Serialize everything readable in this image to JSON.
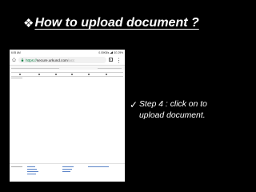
{
  "slide": {
    "title_bullet": "❖",
    "title": "How to upload document ?",
    "step_bullet": "✓",
    "step_text": "Step 4 : click on to upload document.",
    "colors": {
      "background": "#000000",
      "text": "#ffffff"
    }
  },
  "screenshot": {
    "status_bar": {
      "time": "6:05 AM",
      "network": "0.00KB/s",
      "battery_text": "3G",
      "battery_percent": "29%"
    },
    "url_bar": {
      "scheme": "https://",
      "host": "secure.urkund.com",
      "path": "/acc",
      "tab_count": "5",
      "icons": [
        "home-icon",
        "lock-icon",
        "tabs-icon",
        "menu-icon"
      ]
    }
  }
}
